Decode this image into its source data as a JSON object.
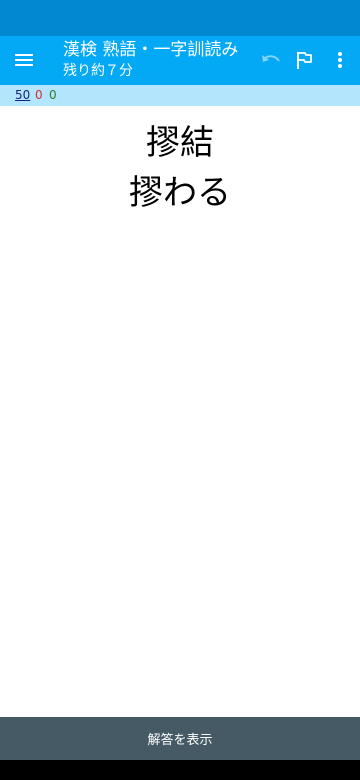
{
  "app_bar": {
    "title": "漢検 熟語・一字訓読み",
    "subtitle": "残り約７分",
    "icons": [
      "menu-icon",
      "undo-icon",
      "flag-icon",
      "more-vert-icon"
    ],
    "colors": {
      "primary": "#03a9f4",
      "primary_dark": "#0288d1"
    }
  },
  "score": {
    "total": "50",
    "wrong": "0",
    "right": "0",
    "colors": {
      "total": "#1a237e",
      "wrong": "#d32f2f",
      "right": "#2e7d32"
    }
  },
  "question": {
    "compound": "摎結",
    "kun_reading": "摎わる"
  },
  "footer": {
    "show_answer_label": "解答を表示",
    "color": "#455a64"
  }
}
